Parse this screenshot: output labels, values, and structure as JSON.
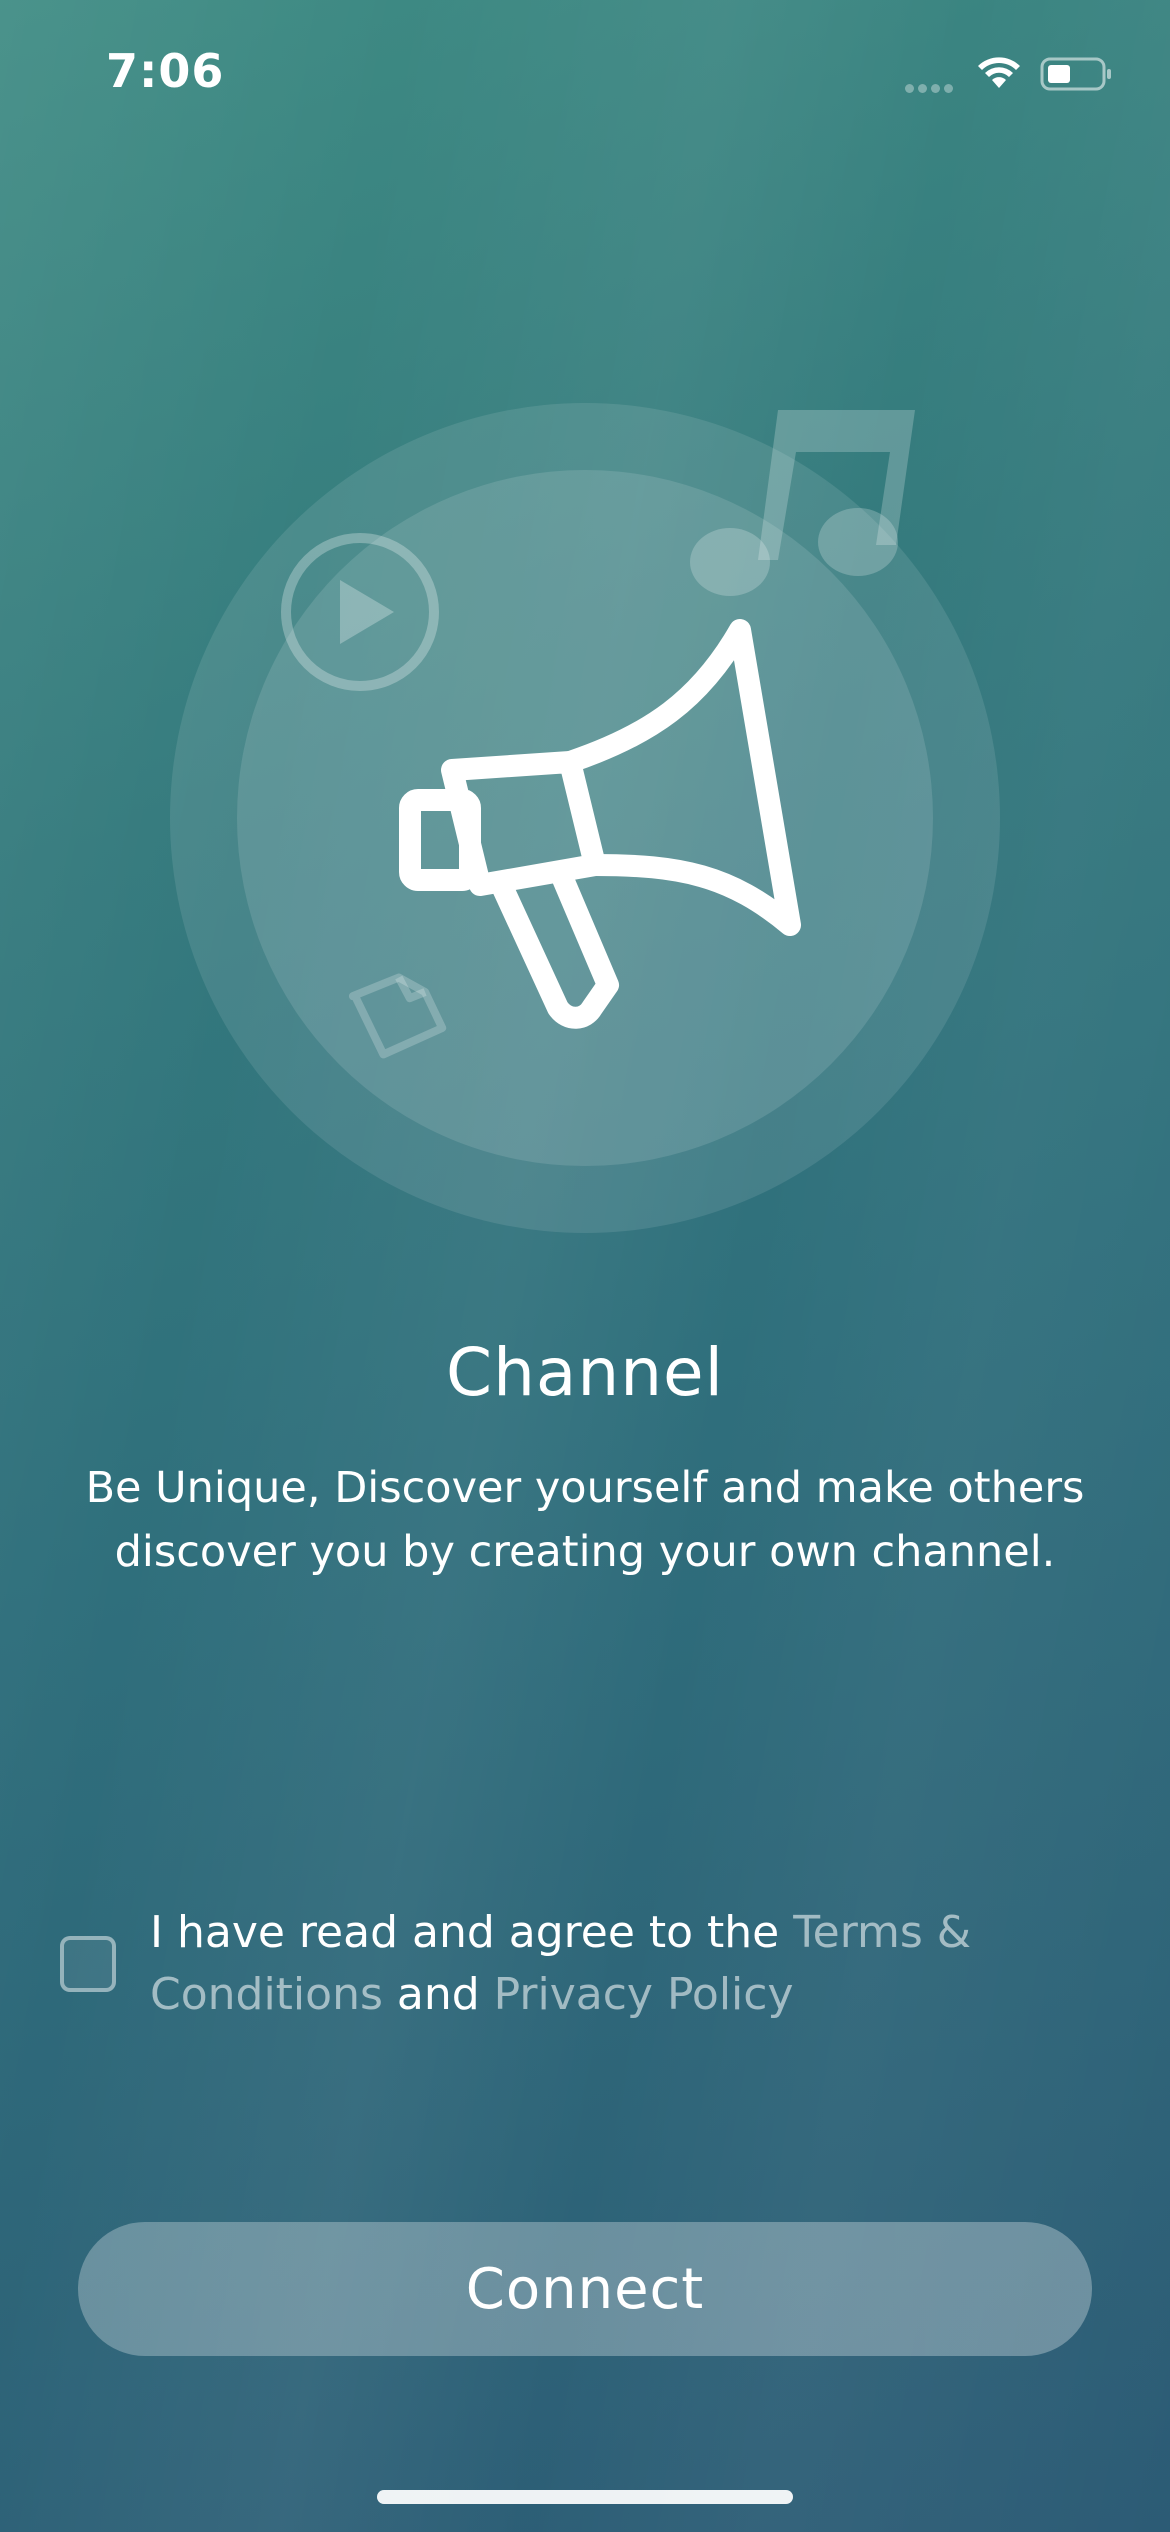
{
  "status_bar": {
    "time": "7:06"
  },
  "onboarding": {
    "title": "Channel",
    "description": "Be Unique, Discover yourself and make others discover you by creating your own channel."
  },
  "agreement": {
    "prefix": "I have read and agree to the ",
    "terms_link": "Terms & Conditions",
    "conjunction": " and ",
    "privacy_link": "Privacy Policy",
    "checked": false
  },
  "actions": {
    "connect_label": "Connect"
  },
  "icons": {
    "illustration_main": "megaphone-icon",
    "illustration_decor": [
      "play-icon",
      "music-note-icon",
      "document-icon"
    ]
  },
  "colors": {
    "gradient_start": "#3f8c84",
    "gradient_end": "#2c5b75",
    "link": "rgba(255,255,255,0.55)"
  }
}
